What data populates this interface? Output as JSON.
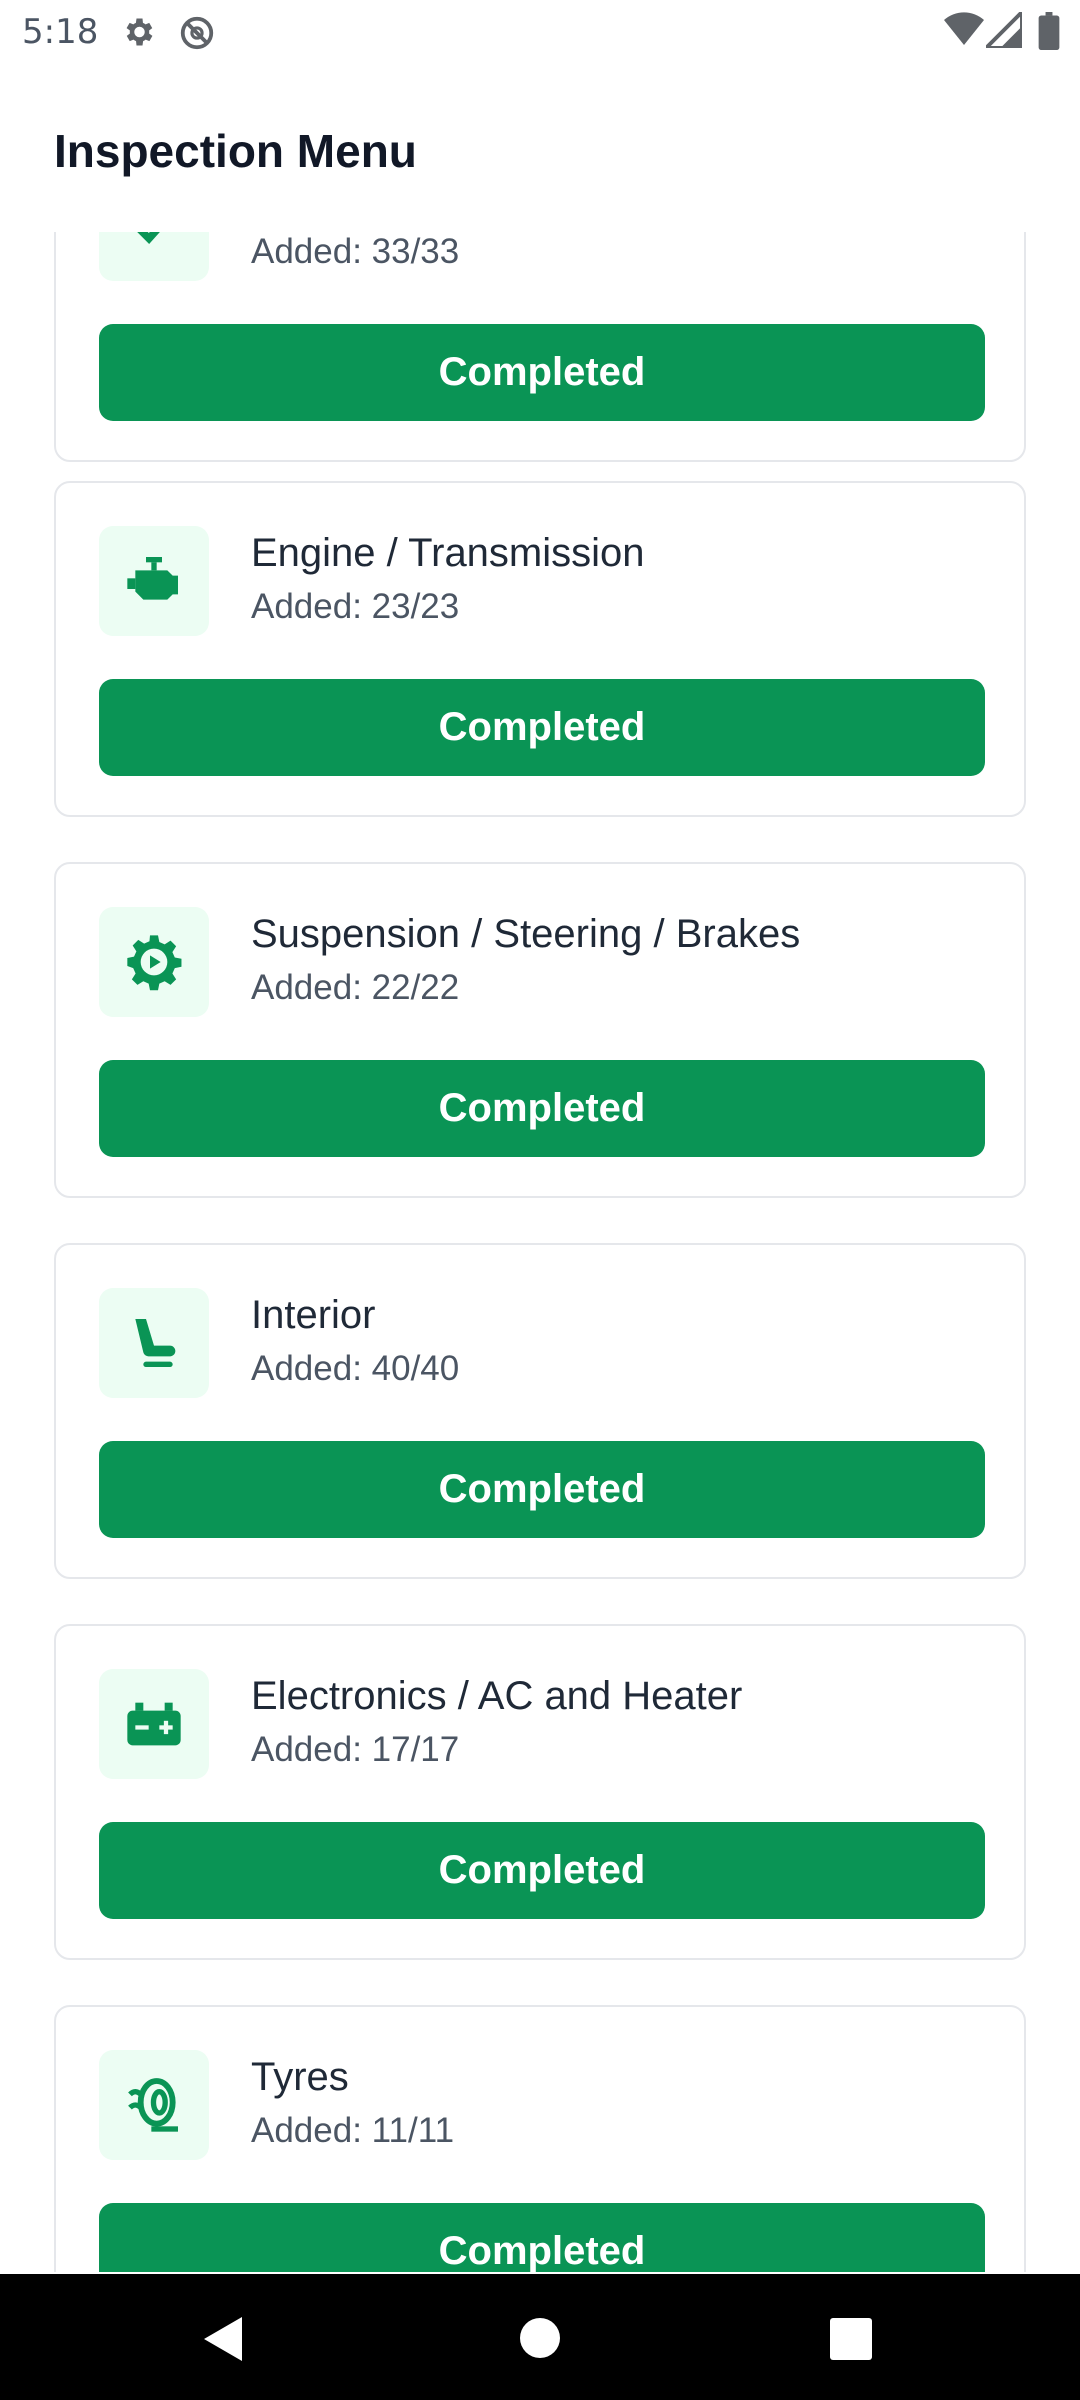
{
  "status_bar": {
    "time": "5:18"
  },
  "header": {
    "title": "Inspection Menu"
  },
  "cards": [
    {
      "title": "",
      "added": "Added: 33/33",
      "button": "Completed",
      "icon": "check-icon"
    },
    {
      "title": "Engine / Transmission",
      "added": "Added: 23/23",
      "button": "Completed",
      "icon": "engine-icon"
    },
    {
      "title": "Suspension / Steering / Brakes",
      "added": "Added: 22/22",
      "button": "Completed",
      "icon": "gear-icon"
    },
    {
      "title": "Interior",
      "added": "Added: 40/40",
      "button": "Completed",
      "icon": "seat-icon"
    },
    {
      "title": "Electronics / AC and Heater",
      "added": "Added: 17/17",
      "button": "Completed",
      "icon": "battery-icon"
    },
    {
      "title": "Tyres",
      "added": "Added: 11/11",
      "button": "Completed",
      "icon": "tyre-icon"
    }
  ],
  "colors": {
    "accent": "#0a9455",
    "icon_bg": "#ecfdf3",
    "card_border": "#e5e7eb"
  }
}
